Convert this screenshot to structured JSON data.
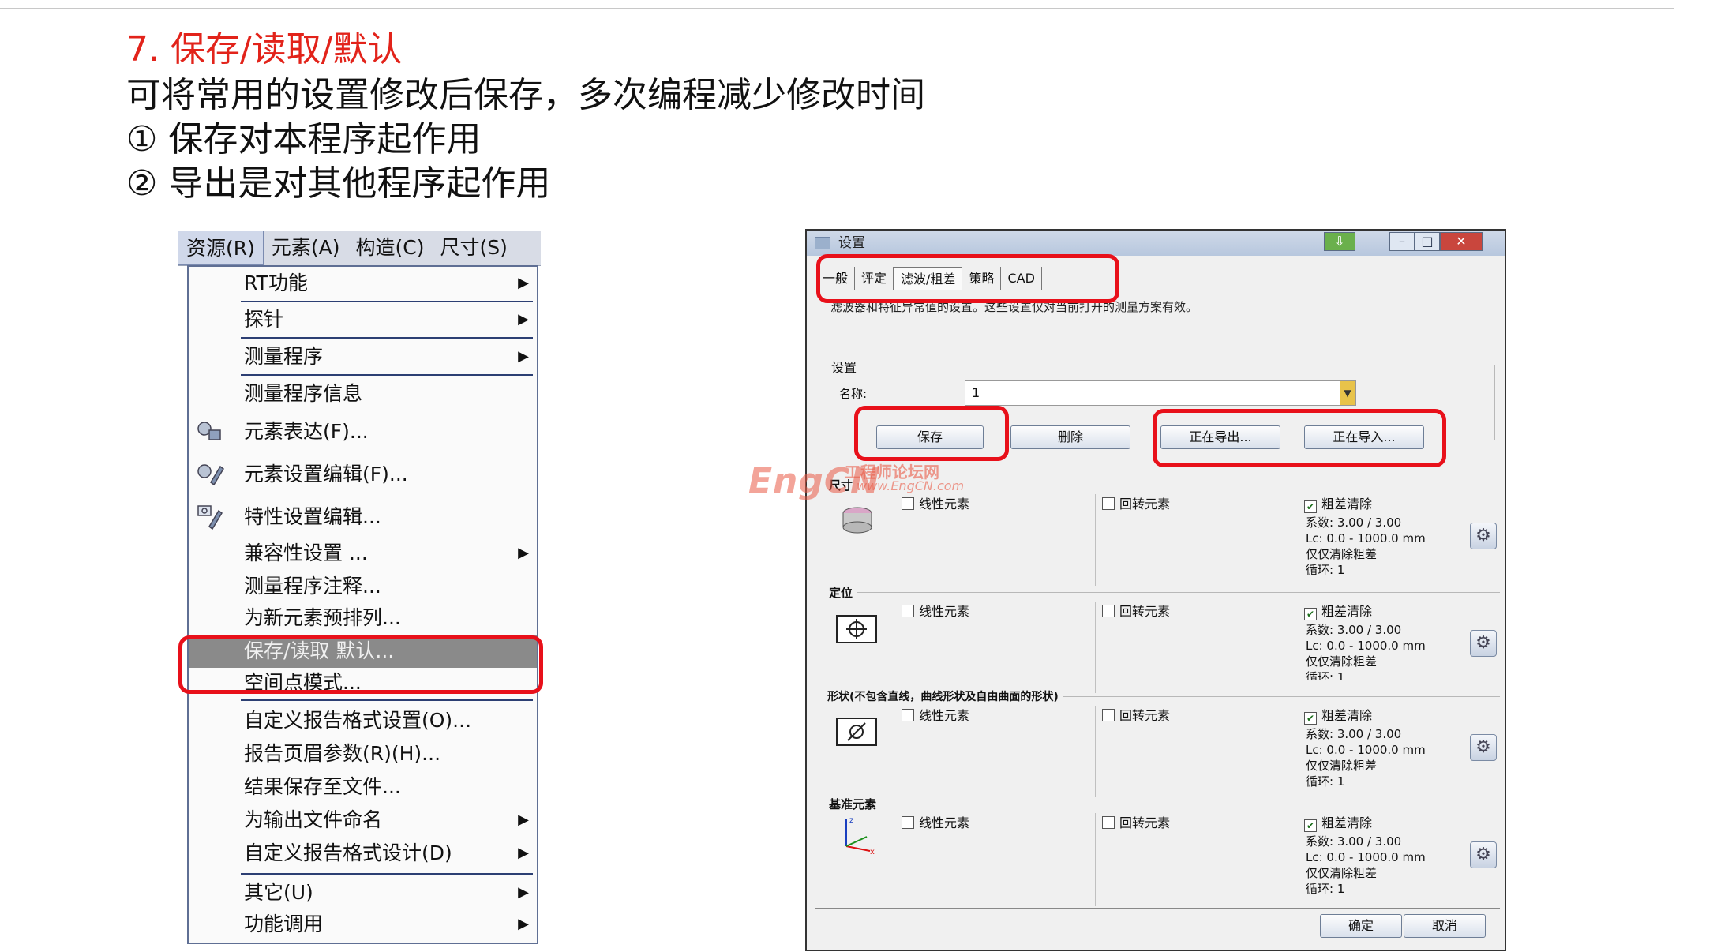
{
  "slide": {
    "title": "7.  保存/读取/默认",
    "lines": [
      "可将常用的设置修改后保存，多次编程减少修改时间",
      "①  保存对本程序起作用",
      "②  导出是对其他程序起作用"
    ]
  },
  "menubar": {
    "items": [
      "资源(R)",
      "元素(A)",
      "构造(C)",
      "尺寸(S)"
    ]
  },
  "menu": {
    "items": [
      {
        "label": "RT功能",
        "submenu": true
      },
      {
        "label": "探针",
        "submenu": true
      },
      {
        "label": "测量程序",
        "submenu": true
      },
      {
        "label": "测量程序信息",
        "submenu": false
      },
      {
        "label": "元素表达(F)...",
        "submenu": false,
        "icon": "element-expression-icon"
      },
      {
        "label": "元素设置编辑(F)...",
        "submenu": false,
        "icon": "element-settings-icon"
      },
      {
        "label": "特性设置编辑...",
        "submenu": false,
        "icon": "characteristic-settings-icon"
      },
      {
        "label": "兼容性设置  ...",
        "submenu": true
      },
      {
        "label": "测量程序注释...",
        "submenu": false
      },
      {
        "label": "为新元素预排列...",
        "submenu": false
      },
      {
        "label": "保存/读取 默认...",
        "submenu": false,
        "highlighted": true
      },
      {
        "label": "空间点模式...",
        "submenu": false
      },
      {
        "label": "自定义报告格式设置(O)...",
        "submenu": false
      },
      {
        "label": "报告页眉参数(R)(H)...",
        "submenu": false
      },
      {
        "label": "结果保存至文件...",
        "submenu": false
      },
      {
        "label": "为输出文件命名",
        "submenu": true
      },
      {
        "label": "自定义报告格式设计(D)",
        "submenu": true
      },
      {
        "label": "其它(U)",
        "submenu": true
      },
      {
        "label": "功能调用",
        "submenu": true
      }
    ]
  },
  "dialog": {
    "title": "设置",
    "tabs": [
      "一般",
      "评定",
      "滤波/粗差",
      "策略",
      "CAD"
    ],
    "description": "滤波器和特征异常值的设置。这些设置仅对当前打开的测量方案有效。",
    "settings_group": "设置",
    "name_label": "名称:",
    "name_value": "1",
    "buttons": {
      "save": "保存",
      "delete": "删除",
      "export": "正在导出...",
      "import": "正在导入...",
      "ok": "确定",
      "cancel": "取消"
    },
    "sections": [
      {
        "label": "尺寸",
        "linear": "线性元素",
        "rotational": "回转元素",
        "outlier": "粗差清除",
        "factor": "系数: 3.00 / 3.00",
        "lc": "Lc: 0.0 - 1000.0 mm",
        "only": "仅仅清除粗差",
        "loop": "循环: 1"
      },
      {
        "label": "定位",
        "linear": "线性元素",
        "rotational": "回转元素",
        "outlier": "粗差清除",
        "factor": "系数: 3.00 / 3.00",
        "lc": "Lc: 0.0 - 1000.0 mm",
        "only": "仅仅清除粗差",
        "loop": "循环: 1"
      },
      {
        "label": "形状(不包含直线，曲线形状及自由曲面的形状)",
        "linear": "线性元素",
        "rotational": "回转元素",
        "outlier": "粗差清除",
        "factor": "系数: 3.00 / 3.00",
        "lc": "Lc: 0.0 - 1000.0 mm",
        "only": "仅仅清除粗差",
        "loop": "循环: 1"
      },
      {
        "label": "基准元素",
        "linear": "线性元素",
        "rotational": "回转元素",
        "outlier": "粗差清除",
        "factor": "系数: 3.00 / 3.00",
        "lc": "Lc: 0.0 - 1000.0 mm",
        "only": "仅仅清除粗差",
        "loop": "循环: 1"
      }
    ]
  },
  "watermark": {
    "logo": "EngCN",
    "cn": "工程师论坛网",
    "url": "www.EngCN.com"
  },
  "colors": {
    "title_red": "#e2231a",
    "annotation_red": "#e8101a",
    "menu_border": "#5f6f94",
    "highlight_gray": "#8a8a8a"
  }
}
